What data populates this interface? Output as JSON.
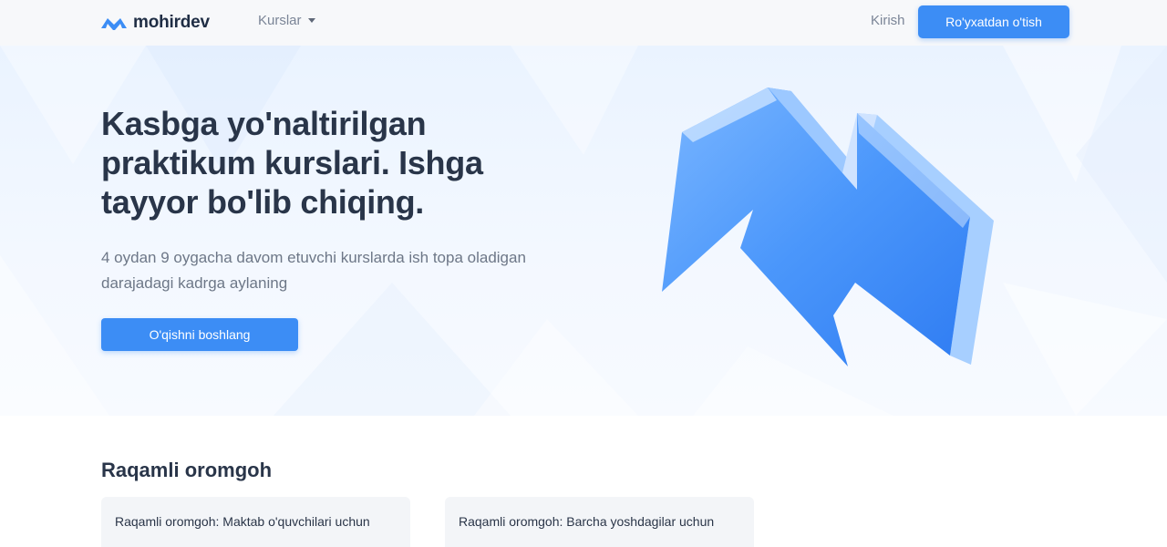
{
  "navbar": {
    "logo_text": "mohirdev",
    "courses_label": "Kurslar",
    "login_label": "Kirish",
    "signup_label": "Ro'yxatdan o'tish"
  },
  "hero": {
    "title": "Kasbga yo'naltirilgan praktikum kurslari. Ishga tayyor bo'lib chiqing.",
    "subtitle": "4 oydan 9 oygacha davom etuvchi kurslarda ish topa oladigan darajadagi kadrga aylaning",
    "cta_label": "O'qishni boshlang"
  },
  "section": {
    "title": "Raqamli oromgoh",
    "cards": [
      {
        "title": "Raqamli oromgoh: Maktab o'quvchilari uchun"
      },
      {
        "title": "Raqamli oromgoh: Barcha yoshdagilar uchun"
      }
    ]
  },
  "colors": {
    "primary": "#3c8df5",
    "heading": "#293549",
    "muted": "#7b8597"
  },
  "icons": {
    "logo": "mohirdev-logo-icon",
    "dropdown": "chevron-down-icon",
    "hero_art": "lightning-bolt-icon"
  }
}
